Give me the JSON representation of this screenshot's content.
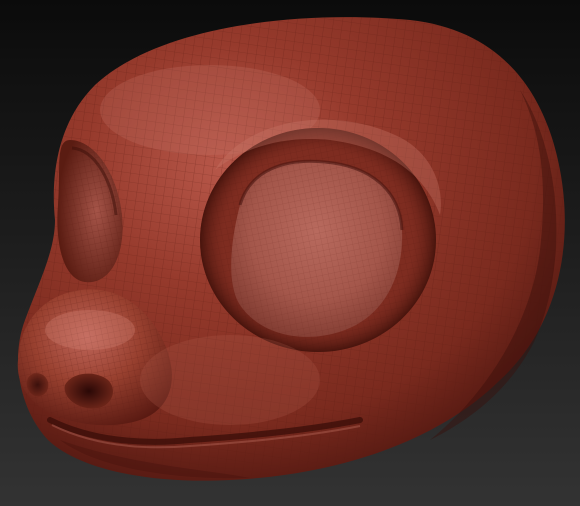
{
  "scene": {
    "subject": "sculpted-animal-head-mesh",
    "background_colors": [
      "#0b0b0b",
      "#333333"
    ],
    "material_colors": {
      "base": "#8a3226",
      "highlight": "#c46a5a",
      "shadow": "#3a0f0a",
      "wire": "#6e2418"
    },
    "wireframe_visible": true
  }
}
